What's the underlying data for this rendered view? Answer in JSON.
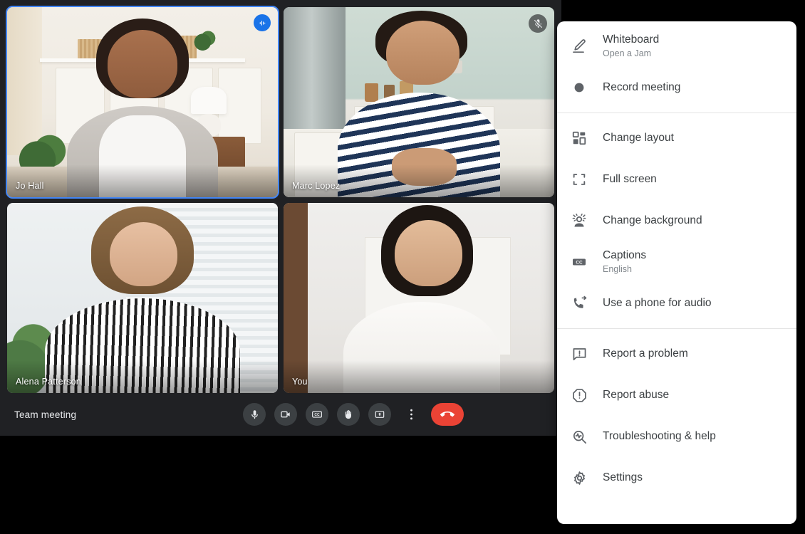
{
  "meeting": {
    "title": "Team meeting",
    "tiles": [
      {
        "name": "Jo Hall",
        "badge": "audio-indicator-icon",
        "active": true
      },
      {
        "name": "Marc Lopez",
        "badge": "mic-off-icon",
        "active": false
      },
      {
        "name": "Alena Patterson",
        "badge": "",
        "active": false
      },
      {
        "name": "You",
        "badge": "",
        "active": false
      }
    ],
    "controls": [
      {
        "name": "microphone-button",
        "icon": "microphone-icon",
        "style": "round"
      },
      {
        "name": "camera-button",
        "icon": "video-camera-icon",
        "style": "round"
      },
      {
        "name": "captions-button",
        "icon": "closed-captions-icon",
        "style": "round"
      },
      {
        "name": "raise-hand-button",
        "icon": "raised-hand-icon",
        "style": "round"
      },
      {
        "name": "present-now-button",
        "icon": "present-screen-icon",
        "style": "round"
      },
      {
        "name": "more-options-button",
        "icon": "more-vertical-icon",
        "style": "plain"
      },
      {
        "name": "leave-call-button",
        "icon": "end-call-icon",
        "style": "hangup"
      }
    ]
  },
  "menu": {
    "sections": [
      {
        "items": [
          {
            "id": "whiteboard",
            "label": "Whiteboard",
            "sub": "Open a Jam",
            "icon": "pen-whiteboard-icon"
          },
          {
            "id": "record-meeting",
            "label": "Record meeting",
            "sub": "",
            "icon": "record-dot-icon"
          }
        ]
      },
      {
        "items": [
          {
            "id": "change-layout",
            "label": "Change layout",
            "sub": "",
            "icon": "layout-grid-icon"
          },
          {
            "id": "full-screen",
            "label": "Full screen",
            "sub": "",
            "icon": "fullscreen-icon"
          },
          {
            "id": "change-background",
            "label": "Change background",
            "sub": "",
            "icon": "change-background-icon"
          },
          {
            "id": "captions",
            "label": "Captions",
            "sub": "English",
            "icon": "closed-captions-icon"
          },
          {
            "id": "use-a-phone-for-audio",
            "label": "Use a phone for audio",
            "sub": "",
            "icon": "phone-forward-icon"
          }
        ]
      },
      {
        "items": [
          {
            "id": "report-a-problem",
            "label": "Report a problem",
            "sub": "",
            "icon": "feedback-icon"
          },
          {
            "id": "report-abuse",
            "label": "Report abuse",
            "sub": "",
            "icon": "report-octagon-icon"
          },
          {
            "id": "troubleshooting-help",
            "label": "Troubleshooting & help",
            "sub": "",
            "icon": "troubleshoot-icon"
          },
          {
            "id": "settings",
            "label": "Settings",
            "sub": "",
            "icon": "gear-icon"
          }
        ]
      }
    ]
  },
  "colors": {
    "accent": "#1a73e8",
    "danger": "#ea4335",
    "surface_dark": "#202124",
    "control_bg": "#3c4043",
    "menu_bg": "#ffffff",
    "menu_label": "#3c4043",
    "menu_sub": "#80868b",
    "page_bg": "#000000"
  }
}
